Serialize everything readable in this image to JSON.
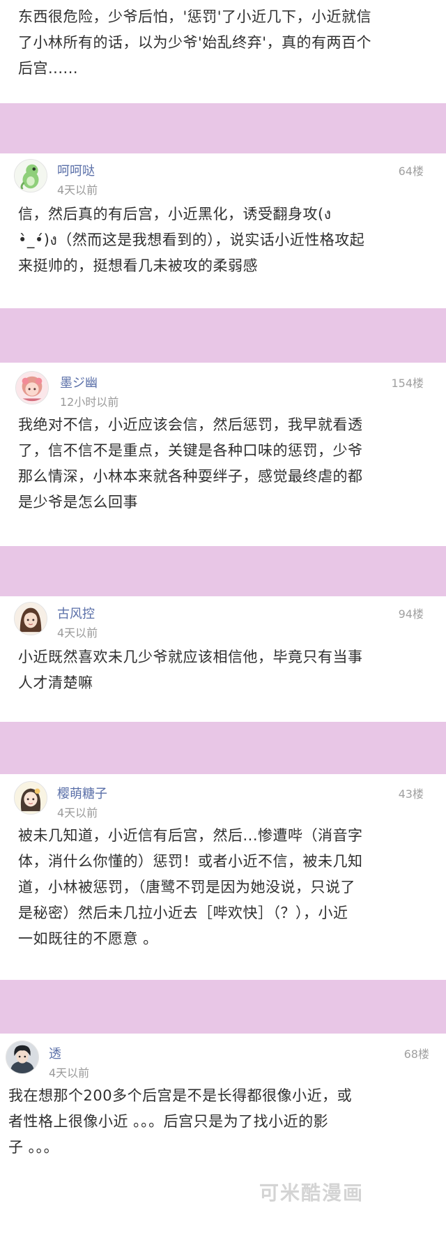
{
  "top_card": {
    "lines": [
      "东西很危险，少爷后怕，'惩罚'了小近几下，小近就信",
      "了小林所有的话，以为少爷'始乱终弃'，真的有两百个",
      "后宫......"
    ]
  },
  "comments": [
    {
      "username": "呵呵哒",
      "time": "4天以前",
      "floor": "64楼",
      "avatar_icon": "green-dinosaur-avatar",
      "lines": [
        "信，然后真的有后宫，小近黑化，诱受翻身攻(ง",
        "•̀_•́)ง（然而这是我想看到的），说实话小近性格攻起",
        "来挺帅的，挺想看几未被攻的柔弱感"
      ]
    },
    {
      "username": "墨ジ幽",
      "time": "12小时以前",
      "floor": "154楼",
      "avatar_icon": "anime-girl-avatar",
      "lines": [
        "我绝对不信，小近应该会信，然后惩罚，我早就看透",
        "了，信不信不是重点，关键是各种口味的惩罚，少爷",
        "那么情深，小林本来就各种耍绊子，感觉最终虐的都",
        "是少爷是怎么回事"
      ]
    },
    {
      "username": "古风控",
      "time": "4天以前",
      "floor": "94楼",
      "avatar_icon": "ancient-style-girl-avatar",
      "lines": [
        "小近既然喜欢未几少爷就应该相信他，毕竟只有当事",
        "人才清楚嘛"
      ]
    },
    {
      "username": "樱萌糖子",
      "time": "4天以前",
      "floor": "43楼",
      "avatar_icon": "sweet-girl-avatar",
      "lines": [
        "被未几知道，小近信有后宫，然后...惨遭哔（消音字",
        "体，消什么你懂的）惩罚！或者小近不信，被未几知",
        "道，小林被惩罚，（唐鹭不罚是因为她没说，只说了",
        "是秘密）然后未几拉小近去［哔欢快］（？），小近",
        "一如既往的不愿意 。"
      ]
    },
    {
      "username": "透",
      "time": "4天以前",
      "floor": "68楼",
      "avatar_icon": "dark-hair-boy-avatar",
      "lines": [
        "我在想那个200多个后宫是不是长得都很像小近，或",
        "者性格上很像小近 。。。后宫只是为了找小近的影",
        "子 。。。"
      ]
    }
  ],
  "watermark": "可米酷漫画"
}
